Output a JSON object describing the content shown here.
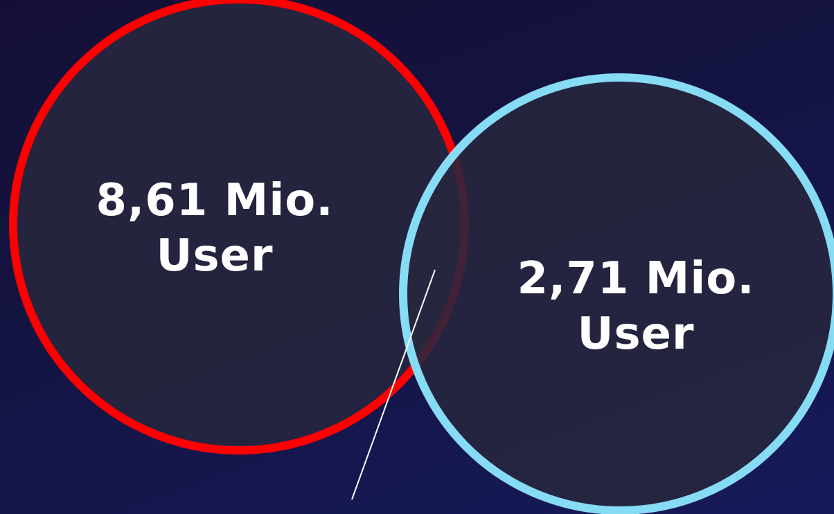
{
  "diagram": {
    "type": "venn",
    "sets": [
      {
        "id": "left",
        "value_line": "8,61 Mio.",
        "unit_line": "User",
        "outline_color": "#ff0000"
      },
      {
        "id": "right",
        "value_line": "2,71 Mio.",
        "unit_line": "User",
        "outline_color": "#87dcf5"
      }
    ],
    "fill_color": "#27273f",
    "callout_line_color": "#ffffff",
    "text_color": "#ffffff"
  }
}
